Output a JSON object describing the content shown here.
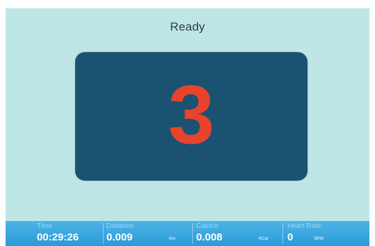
{
  "header": {
    "title": "Ready"
  },
  "countdown": {
    "value": "3"
  },
  "stats": {
    "time": {
      "label": "Time",
      "value": "00:29:26"
    },
    "distance": {
      "label": "Distance",
      "value": "0.009",
      "unit": "Km"
    },
    "calorie": {
      "label": "Calorie",
      "value": "0.008",
      "unit": "KCal"
    },
    "heart_rate": {
      "label": "Heart Rate",
      "value": "0",
      "unit": "BPM"
    }
  },
  "colors": {
    "background": "#bfe6e6",
    "panel": "#1a5272",
    "countdown_number": "#e8432c",
    "status_bar": "#2b9ad8"
  }
}
